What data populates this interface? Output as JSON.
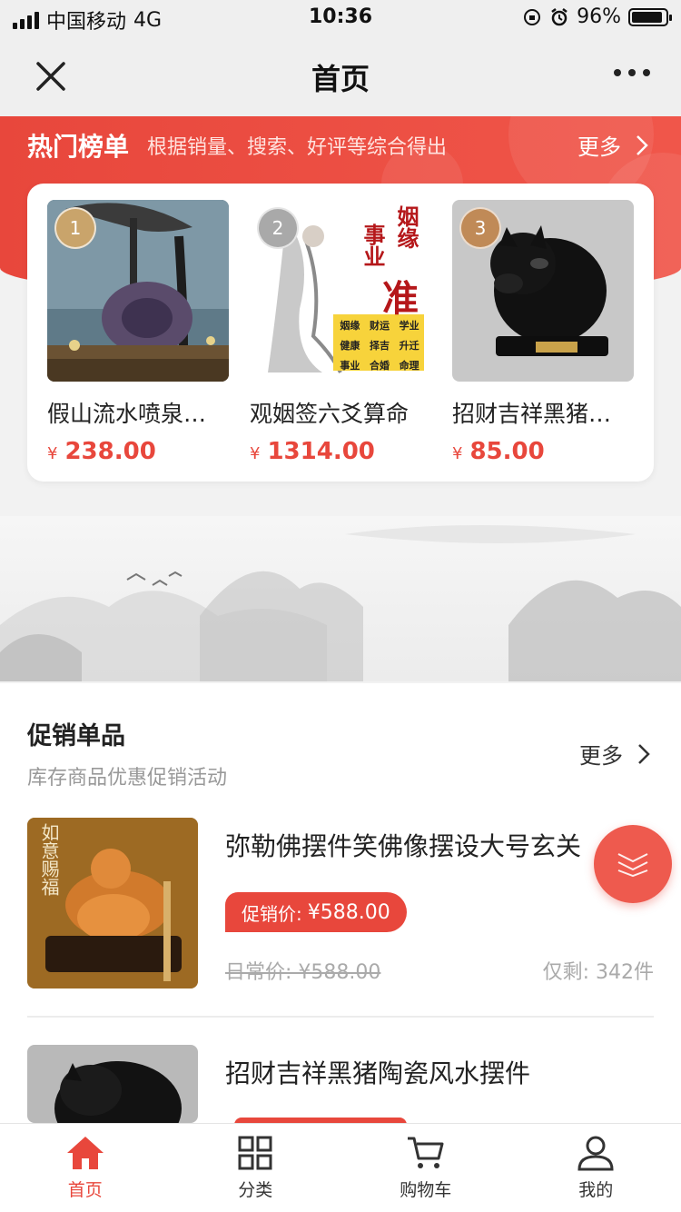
{
  "status_bar": {
    "carrier": "中国移动",
    "network": "4G",
    "time": "10:36",
    "battery": "96%"
  },
  "navbar": {
    "title": "首页"
  },
  "hot": {
    "title": "热门榜单",
    "subtitle": "根据销量、搜索、好评等综合得出",
    "more": "更多",
    "items": [
      {
        "rank": "1",
        "name": "假山流水喷泉摆件",
        "currency": "¥",
        "price": "238.00"
      },
      {
        "rank": "2",
        "name": "观姻签六爻算命",
        "currency": "¥",
        "price": "1314.00"
      },
      {
        "rank": "3",
        "name": "招财吉祥黑猪陶瓷",
        "currency": "¥",
        "price": "85.00"
      }
    ],
    "poster_text": {
      "line1": "姻缘",
      "line2": "事业",
      "big": "准",
      "grid": [
        "姻缘",
        "财运",
        "学业",
        "健康",
        "择吉",
        "升迁",
        "事业",
        "合婚",
        "命理"
      ]
    }
  },
  "promo": {
    "title": "促销单品",
    "subtitle": "库存商品优惠促销活动",
    "more": "更多",
    "items": [
      {
        "name": "弥勒佛摆件笑佛像摆设大号玄关",
        "badge_label": "促销价:",
        "promo_price": "¥588.00",
        "daily_price": "日常价: ¥588.00",
        "stock": "仅剩: 342件",
        "image_text": "如意赐福"
      },
      {
        "name": "招财吉祥黑猪陶瓷风水摆件"
      }
    ]
  },
  "tabbar": [
    {
      "label": "首页",
      "icon": "home-icon",
      "active": true
    },
    {
      "label": "分类",
      "icon": "grid-icon",
      "active": false
    },
    {
      "label": "购物车",
      "icon": "cart-icon",
      "active": false
    },
    {
      "label": "我的",
      "icon": "user-icon",
      "active": false
    }
  ],
  "colors": {
    "accent": "#e8473c",
    "background": "#f2f2f2"
  }
}
